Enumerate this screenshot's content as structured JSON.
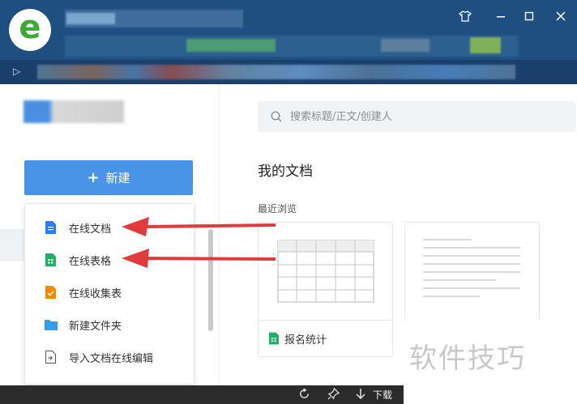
{
  "browser": {
    "logo_letter": "e",
    "window_buttons": {
      "skin_icon": "tshirt-icon",
      "minimize_icon": "minimize-icon",
      "maximize_icon": "maximize-icon",
      "close_icon": "close-icon"
    }
  },
  "sidebar": {
    "new_button": {
      "icon": "plus-icon",
      "label": "新建"
    },
    "new_menu": [
      {
        "label": "在线文档",
        "icon": "doc-icon",
        "color": "#2f7cf0"
      },
      {
        "label": "在线表格",
        "icon": "sheet-icon",
        "color": "#1fae63"
      },
      {
        "label": "在线收集表",
        "icon": "form-icon",
        "color": "#f08a00"
      },
      {
        "label": "新建文件夹",
        "icon": "folder-icon",
        "color": "#2fa0f0"
      },
      {
        "label": "导入文档在线编辑",
        "icon": "import-icon",
        "color": "#555555"
      }
    ]
  },
  "main": {
    "search": {
      "placeholder": "搜索标题/正文/创建人"
    },
    "section_title": "我的文档",
    "recent_label": "最近浏览",
    "recent_docs": [
      {
        "title": "报名统计",
        "icon": "sheet-icon",
        "type": "sheet"
      },
      {
        "title": "",
        "icon": "doc-icon",
        "type": "doc"
      }
    ]
  },
  "watermark": "软件技巧",
  "statusbar": {
    "icons": [
      "refresh-icon",
      "pin-icon",
      "download-icon"
    ],
    "download_label": "下载"
  },
  "annotations": {
    "arrow_color": "#e03c3c"
  },
  "colors": {
    "accent": "#4a94e8",
    "titlebar": "#1f4f80",
    "sheet_green": "#1fae63",
    "doc_blue": "#2f7cf0"
  }
}
